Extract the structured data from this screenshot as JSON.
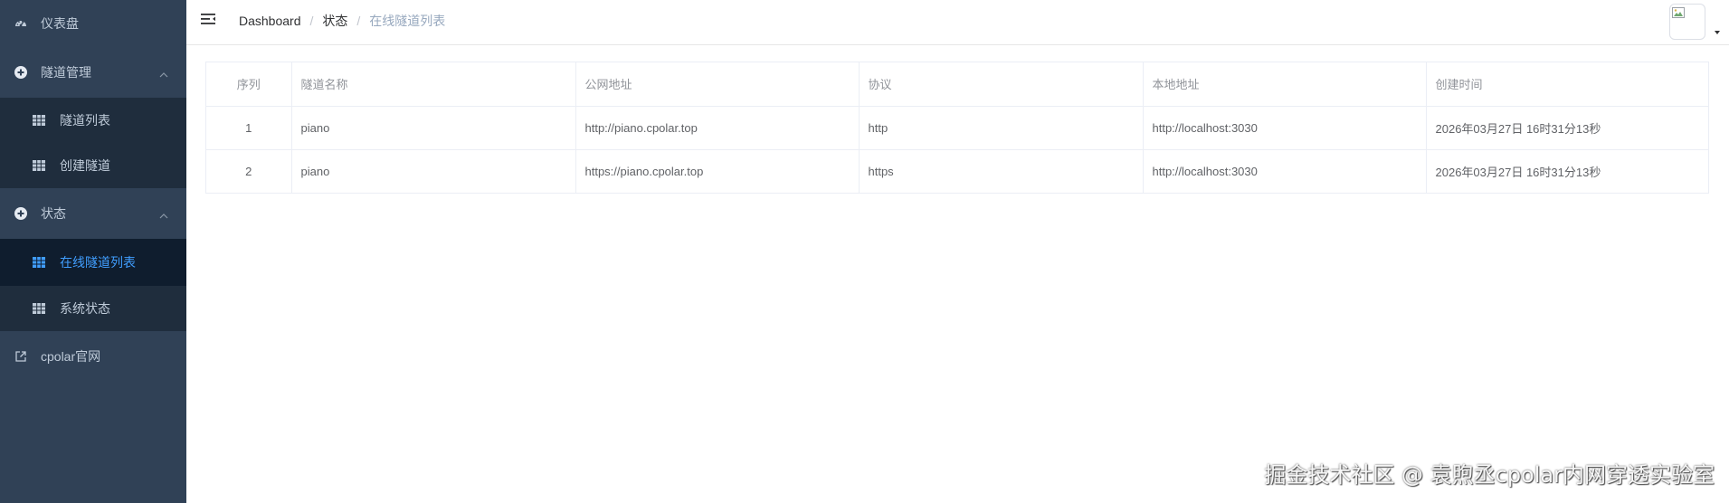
{
  "sidebar": {
    "dashboard": {
      "label": "仪表盘",
      "icon": "dashboard-icon"
    },
    "tunnel_mgmt": {
      "label": "隧道管理",
      "icon": "plus-circle-icon",
      "children": [
        {
          "label": "隧道列表",
          "icon": "table-icon"
        },
        {
          "label": "创建隧道",
          "icon": "table-icon"
        }
      ]
    },
    "status": {
      "label": "状态",
      "icon": "plus-circle-icon",
      "children": [
        {
          "label": "在线隧道列表",
          "icon": "table-icon",
          "active": true
        },
        {
          "label": "系统状态",
          "icon": "table-icon"
        }
      ]
    },
    "website": {
      "label": "cpolar官网",
      "icon": "external-link-icon"
    }
  },
  "header": {
    "breadcrumb": [
      "Dashboard",
      "状态",
      "在线隧道列表"
    ],
    "separator": "/"
  },
  "table": {
    "columns": [
      "序列",
      "隧道名称",
      "公网地址",
      "协议",
      "本地地址",
      "创建时间"
    ],
    "rows": [
      [
        "1",
        "piano",
        "http://piano.cpolar.top",
        "http",
        "http://localhost:3030",
        "2026年03月27日 16时31分13秒"
      ],
      [
        "2",
        "piano",
        "https://piano.cpolar.top",
        "https",
        "http://localhost:3030",
        "2026年03月27日 16时31分13秒"
      ]
    ]
  },
  "watermark": "掘金技术社区 @ 袁煦丞cpolar内网穿透实验室",
  "colors": {
    "sidebar_bg": "#304156",
    "submenu_bg": "#1f2d3d",
    "active_text": "#409eff",
    "menu_text": "#bfcbd9"
  }
}
